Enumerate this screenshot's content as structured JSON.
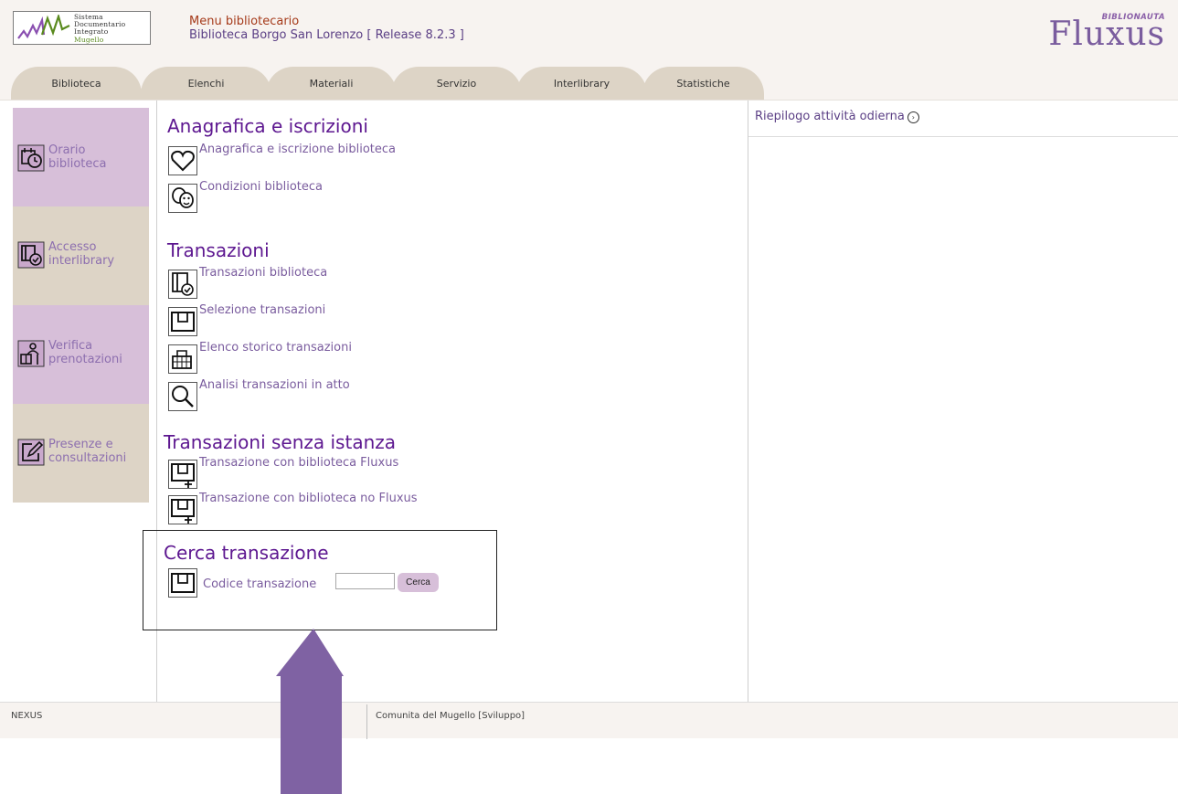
{
  "header": {
    "logo": {
      "line1": "Sistema",
      "line2": "Documentario",
      "line3": "Integrato",
      "line4": "Mugello",
      "colors": {
        "green": "#5a8a1e",
        "purple": "#8a4fb0"
      }
    },
    "menu_title": "Menu bibliotecario",
    "menu_subtitle": "Biblioteca Borgo San Lorenzo [ Release 8.2.3 ]",
    "brand_small": "BIBLIONAUTA",
    "brand_big": "Fluxus"
  },
  "tabs": [
    "Biblioteca",
    "Elenchi",
    "Materiali",
    "Servizio",
    "Interlibrary",
    "Statistiche"
  ],
  "sidebar": [
    {
      "label_line1": "Orario",
      "label_line2": "biblioteca",
      "icon": "calendar-clock-icon",
      "color": "#d7bfd9"
    },
    {
      "label_line1": "Accesso",
      "label_line2": "interlibrary",
      "icon": "book-check-icon",
      "color": "#ddd4c6"
    },
    {
      "label_line1": "Verifica",
      "label_line2": "prenotazioni",
      "icon": "person-books-icon",
      "color": "#d7bfd9"
    },
    {
      "label_line1": "Presenze e",
      "label_line2": "consultazioni",
      "icon": "edit-note-icon",
      "color": "#ddd4c6"
    }
  ],
  "sections": {
    "anagrafica": {
      "title": "Anagrafica e iscrizioni",
      "items": [
        "Anagrafica e iscrizione biblioteca",
        "Condizioni biblioteca"
      ]
    },
    "transazioni": {
      "title": "Transazioni",
      "items": [
        "Transazioni biblioteca",
        "Selezione transazioni",
        "Elenco storico transazioni",
        "Analisi transazioni in atto"
      ]
    },
    "senza_istanza": {
      "title": "Transazioni senza istanza",
      "items": [
        "Transazione con biblioteca Fluxus",
        "Transazione con biblioteca no Fluxus"
      ]
    },
    "cerca": {
      "title": "Cerca transazione",
      "field_label": "Codice transazione",
      "field_value": "",
      "button_label": "Cerca"
    }
  },
  "right_panel": {
    "title": "Riepilogo attività odierna",
    "arrow": "›"
  },
  "footer": {
    "left": "NEXUS",
    "right": "Comunita del Mugello [Sviluppo]"
  },
  "colors": {
    "accent": "#5d1790",
    "link": "#7a5c9e",
    "tab": "#ddd4c6",
    "sidebar_purple": "#d7bfd9",
    "annotation_arrow": "#7f62a3"
  }
}
